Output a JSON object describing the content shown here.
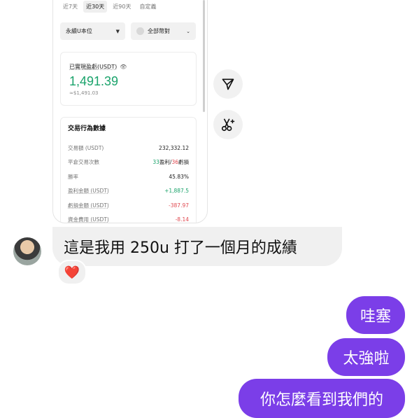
{
  "screenshot": {
    "tabs": [
      "近7天",
      "近30天",
      "近90天",
      "自定義"
    ],
    "active_tab": 1,
    "select_left": "永續U本位",
    "select_right": "全部幣對",
    "pnl_label": "已實現盈虧(USDT)",
    "pnl_value": "1,491.39",
    "pnl_sub": "≈$1,491.03",
    "stats_title": "交易行為數據",
    "stats": [
      {
        "key": "交易額 (USDT)",
        "value": "232,332.12"
      },
      {
        "key": "平倉交易次數",
        "win": "33",
        "win_label": "盈利",
        "sep": "/",
        "loss": "36",
        "loss_label": "虧損"
      },
      {
        "key": "勝率",
        "value": "45.83%"
      },
      {
        "key": "盈利金額 (USDT)",
        "value": "+1,887.5",
        "tone": "green"
      },
      {
        "key": "虧損金額 (USDT)",
        "value": "-387.97",
        "tone": "red"
      },
      {
        "key": "資金費用 (USDT)",
        "value": "-8.14",
        "tone": "red"
      }
    ]
  },
  "actions": {
    "share_icon": "send-icon",
    "remix_icon": "scissors-sparkle-icon"
  },
  "chat": {
    "incoming": "這是我用 250u 打了一個月的成績",
    "reaction": "❤️",
    "outgoing": [
      "哇塞",
      "太強啦",
      "你怎麼看到我們的"
    ]
  },
  "colors": {
    "accent": "#7b3ee8",
    "profit": "#1aa36b",
    "loss": "#e0484f",
    "bubble_in": "#f0f0f0"
  }
}
